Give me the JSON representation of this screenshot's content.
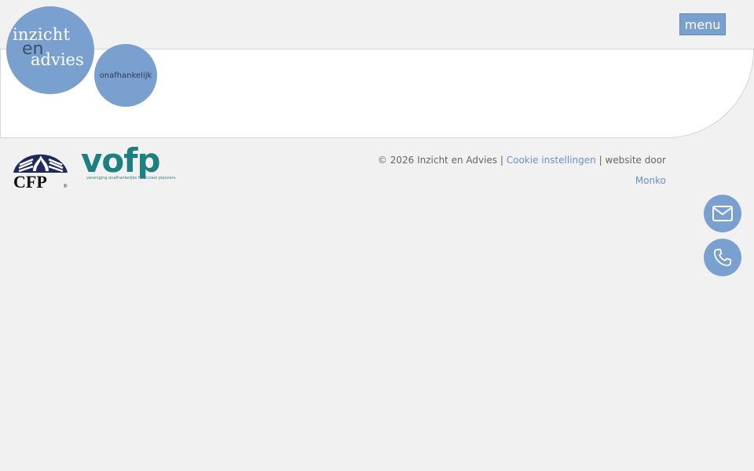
{
  "logo": {
    "line1": "inzicht",
    "line2": "en",
    "line3": "advies",
    "badge": "onafhankelijk"
  },
  "header": {
    "menu_label": "menu"
  },
  "partners": {
    "cfp_label": "CFP",
    "vofp_label": "vofp",
    "vofp_tagline": "vereniging onafhankelijke financieel planners"
  },
  "footer": {
    "copyright": "© 2026 Inzicht en Advies | ",
    "cookie_link": "Cookie instellingen",
    "separator": " | website door",
    "agency_link": "Monko"
  },
  "contact": {
    "mail_icon": "envelope-icon",
    "phone_icon": "phone-icon"
  },
  "colors": {
    "brand_blue": "#7aa0cf",
    "background": "#f1f1f1",
    "vofp_teal": "#1d7f80",
    "cfp_navy": "#1f2a5c"
  }
}
